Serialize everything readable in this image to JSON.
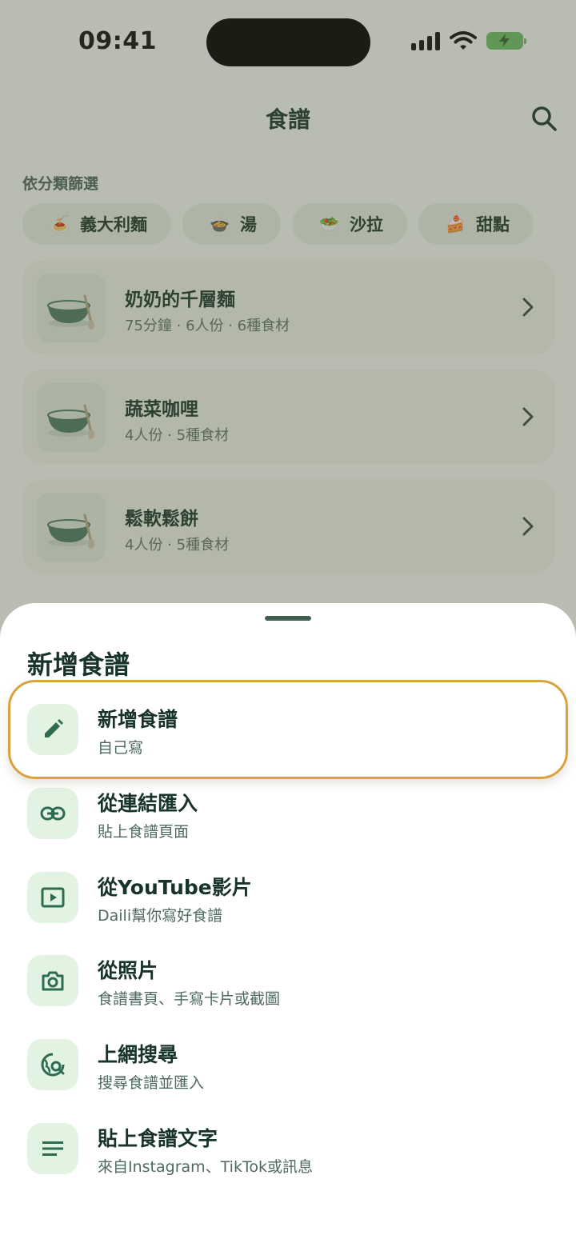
{
  "status": {
    "time": "09:41"
  },
  "header": {
    "title": "食譜"
  },
  "filters": {
    "label": "依分類篩選",
    "chips": [
      {
        "emoji": "🍝",
        "label": "義大利麵"
      },
      {
        "emoji": "🍲",
        "label": "湯"
      },
      {
        "emoji": "🥗",
        "label": "沙拉"
      },
      {
        "emoji": "🍰",
        "label": "甜點"
      }
    ]
  },
  "recipes": [
    {
      "title": "奶奶的千層麵",
      "meta": "75分鐘 · 6人份 · 6種食材"
    },
    {
      "title": "蔬菜咖哩",
      "meta": "4人份 · 5種食材"
    },
    {
      "title": "鬆軟鬆餅",
      "meta": "4人份 · 5種食材"
    }
  ],
  "sheet": {
    "title": "新增食譜",
    "options": [
      {
        "title": "新增食譜",
        "subtitle": "自己寫",
        "icon": "pencil-icon"
      },
      {
        "title": "從連結匯入",
        "subtitle": "貼上食譜頁面",
        "icon": "link-icon"
      },
      {
        "title": "從YouTube影片",
        "subtitle": "Daili幫你寫好食譜",
        "icon": "video-icon"
      },
      {
        "title": "從照片",
        "subtitle": "食譜書頁、手寫卡片或截圖",
        "icon": "camera-icon"
      },
      {
        "title": "上網搜尋",
        "subtitle": "搜尋食譜並匯入",
        "icon": "globe-search-icon"
      },
      {
        "title": "貼上食譜文字",
        "subtitle": "來自Instagram、TikTok或訊息",
        "icon": "text-lines-icon"
      }
    ]
  },
  "colors": {
    "accent": "#2e6b4f",
    "highlight": "#d9a23f",
    "battery": "#6cc06a"
  }
}
